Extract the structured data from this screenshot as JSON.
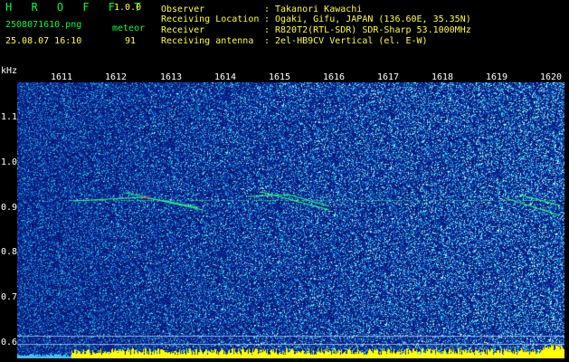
{
  "app": {
    "name": "H R O F F T",
    "version": "1.0.0"
  },
  "file": {
    "filename": "2508071610.png",
    "datetime": "25.08.07 16:10",
    "mode_label": "meteor",
    "count": "91"
  },
  "info": [
    {
      "label": "Observer",
      "value": "Takanori Kawachi"
    },
    {
      "label": "Receiving Location",
      "value": "Ogaki, Gifu, JAPAN (136.60E, 35.35N)"
    },
    {
      "label": "Receiver",
      "value": "R820T2(RTL-SDR) SDR-Sharp 53.1000MHz"
    },
    {
      "label": "Receiving antenna",
      "value": "2el-HB9CV Vertical (el. E-W)"
    }
  ],
  "axes": {
    "freq_unit": "kHz",
    "time_ticks": [
      "1611",
      "1612",
      "1613",
      "1614",
      "1615",
      "1616",
      "1617",
      "1618",
      "1619",
      "1620"
    ],
    "freq_ticks": [
      "1.1",
      "1.0",
      "0.9",
      "0.8",
      "0.7",
      "0.6"
    ]
  },
  "colors": {
    "background": "#000000",
    "noise_base": "#102090",
    "logo": "#00ff40",
    "label": "#ffff40",
    "echo": "#30ff80",
    "floor": "#ffff00"
  }
}
